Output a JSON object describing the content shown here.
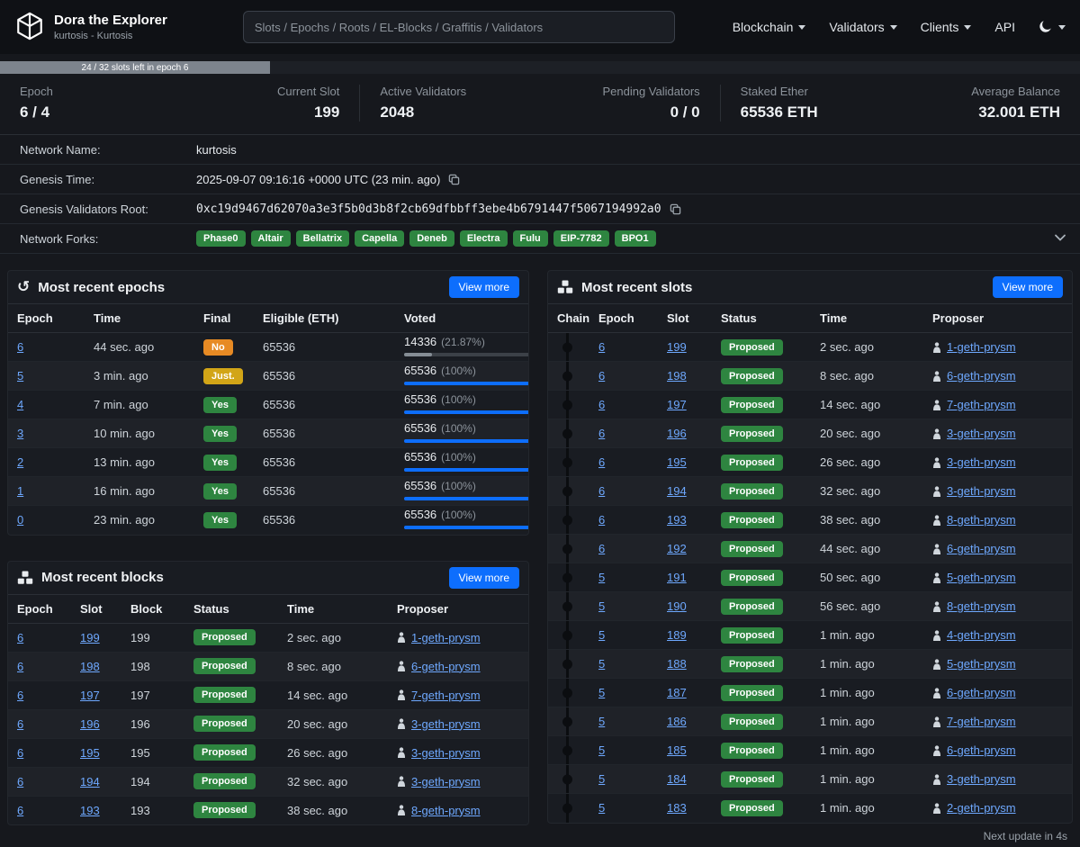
{
  "navbar": {
    "brand_title": "Dora the Explorer",
    "brand_subtitle": "kurtosis - Kurtosis",
    "search_placeholder": "Slots / Epochs / Roots / EL-Blocks / Graffitis / Validators",
    "menu": [
      {
        "label": "Blockchain"
      },
      {
        "label": "Validators"
      },
      {
        "label": "Clients"
      },
      {
        "label": "API"
      }
    ]
  },
  "epoch_progress": {
    "label": "24 / 32 slots left in epoch 6",
    "percent": 25
  },
  "stats": [
    {
      "label": "Epoch",
      "value": "6 / 4"
    },
    {
      "label": "Current Slot",
      "value": "199"
    },
    {
      "label": "Active Validators",
      "value": "2048"
    },
    {
      "label": "Pending Validators",
      "value": "0 / 0"
    },
    {
      "label": "Staked Ether",
      "value": "65536 ETH"
    },
    {
      "label": "Average Balance",
      "value": "32.001 ETH"
    }
  ],
  "network_info": {
    "rows": [
      {
        "label": "Network Name:",
        "value": "kurtosis"
      },
      {
        "label": "Genesis Time:",
        "value": "2025-09-07 09:16:16 +0000 UTC (23 min. ago)"
      },
      {
        "label": "Genesis Validators Root:",
        "value": "0xc19d9467d62070a3e3f5b0d3b8f2cb69dfbbff3ebe4b6791447f5067194992a0"
      },
      {
        "label": "Network Forks:"
      }
    ],
    "forks": [
      "Phase0",
      "Altair",
      "Bellatrix",
      "Capella",
      "Deneb",
      "Electra",
      "Fulu",
      "EIP-7782",
      "BPO1"
    ]
  },
  "icons": {
    "history_glyph": "↺"
  },
  "epochs_card": {
    "title": "Most recent epochs",
    "view_more": "View more",
    "headers": [
      "Epoch",
      "Time",
      "Final",
      "Eligible (ETH)",
      "Voted"
    ],
    "rows": [
      {
        "epoch": "6",
        "time": "44 sec. ago",
        "final": "No",
        "final_type": "no",
        "eligible": "65536",
        "voted_amount": "14336",
        "voted_pct_label": "(21.87%)",
        "voted_pct": 21.87
      },
      {
        "epoch": "5",
        "time": "3 min. ago",
        "final": "Just.",
        "final_type": "just",
        "eligible": "65536",
        "voted_amount": "65536",
        "voted_pct_label": "(100%)",
        "voted_pct": 100
      },
      {
        "epoch": "4",
        "time": "7 min. ago",
        "final": "Yes",
        "final_type": "yes",
        "eligible": "65536",
        "voted_amount": "65536",
        "voted_pct_label": "(100%)",
        "voted_pct": 100
      },
      {
        "epoch": "3",
        "time": "10 min. ago",
        "final": "Yes",
        "final_type": "yes",
        "eligible": "65536",
        "voted_amount": "65536",
        "voted_pct_label": "(100%)",
        "voted_pct": 100
      },
      {
        "epoch": "2",
        "time": "13 min. ago",
        "final": "Yes",
        "final_type": "yes",
        "eligible": "65536",
        "voted_amount": "65536",
        "voted_pct_label": "(100%)",
        "voted_pct": 100
      },
      {
        "epoch": "1",
        "time": "16 min. ago",
        "final": "Yes",
        "final_type": "yes",
        "eligible": "65536",
        "voted_amount": "65536",
        "voted_pct_label": "(100%)",
        "voted_pct": 100
      },
      {
        "epoch": "0",
        "time": "23 min. ago",
        "final": "Yes",
        "final_type": "yes",
        "eligible": "65536",
        "voted_amount": "65536",
        "voted_pct_label": "(100%)",
        "voted_pct": 100
      }
    ]
  },
  "blocks_card": {
    "title": "Most recent blocks",
    "view_more": "View more",
    "headers": [
      "Epoch",
      "Slot",
      "Block",
      "Status",
      "Time",
      "Proposer"
    ],
    "rows": [
      {
        "epoch": "6",
        "slot": "199",
        "block": "199",
        "status": "Proposed",
        "time": "2 sec. ago",
        "proposer": "1-geth-prysm"
      },
      {
        "epoch": "6",
        "slot": "198",
        "block": "198",
        "status": "Proposed",
        "time": "8 sec. ago",
        "proposer": "6-geth-prysm"
      },
      {
        "epoch": "6",
        "slot": "197",
        "block": "197",
        "status": "Proposed",
        "time": "14 sec. ago",
        "proposer": "7-geth-prysm"
      },
      {
        "epoch": "6",
        "slot": "196",
        "block": "196",
        "status": "Proposed",
        "time": "20 sec. ago",
        "proposer": "3-geth-prysm"
      },
      {
        "epoch": "6",
        "slot": "195",
        "block": "195",
        "status": "Proposed",
        "time": "26 sec. ago",
        "proposer": "3-geth-prysm"
      },
      {
        "epoch": "6",
        "slot": "194",
        "block": "194",
        "status": "Proposed",
        "time": "32 sec. ago",
        "proposer": "3-geth-prysm"
      },
      {
        "epoch": "6",
        "slot": "193",
        "block": "193",
        "status": "Proposed",
        "time": "38 sec. ago",
        "proposer": "8-geth-prysm"
      }
    ]
  },
  "slots_card": {
    "title": "Most recent slots",
    "view_more": "View more",
    "headers": [
      "Chain",
      "Epoch",
      "Slot",
      "Status",
      "Time",
      "Proposer"
    ],
    "rows": [
      {
        "epoch": "6",
        "slot": "199",
        "status": "Proposed",
        "time": "2 sec. ago",
        "proposer": "1-geth-prysm"
      },
      {
        "epoch": "6",
        "slot": "198",
        "status": "Proposed",
        "time": "8 sec. ago",
        "proposer": "6-geth-prysm"
      },
      {
        "epoch": "6",
        "slot": "197",
        "status": "Proposed",
        "time": "14 sec. ago",
        "proposer": "7-geth-prysm"
      },
      {
        "epoch": "6",
        "slot": "196",
        "status": "Proposed",
        "time": "20 sec. ago",
        "proposer": "3-geth-prysm"
      },
      {
        "epoch": "6",
        "slot": "195",
        "status": "Proposed",
        "time": "26 sec. ago",
        "proposer": "3-geth-prysm"
      },
      {
        "epoch": "6",
        "slot": "194",
        "status": "Proposed",
        "time": "32 sec. ago",
        "proposer": "3-geth-prysm"
      },
      {
        "epoch": "6",
        "slot": "193",
        "status": "Proposed",
        "time": "38 sec. ago",
        "proposer": "8-geth-prysm"
      },
      {
        "epoch": "6",
        "slot": "192",
        "status": "Proposed",
        "time": "44 sec. ago",
        "proposer": "6-geth-prysm"
      },
      {
        "epoch": "5",
        "slot": "191",
        "status": "Proposed",
        "time": "50 sec. ago",
        "proposer": "5-geth-prysm"
      },
      {
        "epoch": "5",
        "slot": "190",
        "status": "Proposed",
        "time": "56 sec. ago",
        "proposer": "8-geth-prysm"
      },
      {
        "epoch": "5",
        "slot": "189",
        "status": "Proposed",
        "time": "1 min. ago",
        "proposer": "4-geth-prysm"
      },
      {
        "epoch": "5",
        "slot": "188",
        "status": "Proposed",
        "time": "1 min. ago",
        "proposer": "5-geth-prysm"
      },
      {
        "epoch": "5",
        "slot": "187",
        "status": "Proposed",
        "time": "1 min. ago",
        "proposer": "6-geth-prysm"
      },
      {
        "epoch": "5",
        "slot": "186",
        "status": "Proposed",
        "time": "1 min. ago",
        "proposer": "7-geth-prysm"
      },
      {
        "epoch": "5",
        "slot": "185",
        "status": "Proposed",
        "time": "1 min. ago",
        "proposer": "6-geth-prysm"
      },
      {
        "epoch": "5",
        "slot": "184",
        "status": "Proposed",
        "time": "1 min. ago",
        "proposer": "3-geth-prysm"
      },
      {
        "epoch": "5",
        "slot": "183",
        "status": "Proposed",
        "time": "1 min. ago",
        "proposer": "2-geth-prysm"
      }
    ]
  },
  "footer": {
    "next_update": "Next update in 4s"
  }
}
